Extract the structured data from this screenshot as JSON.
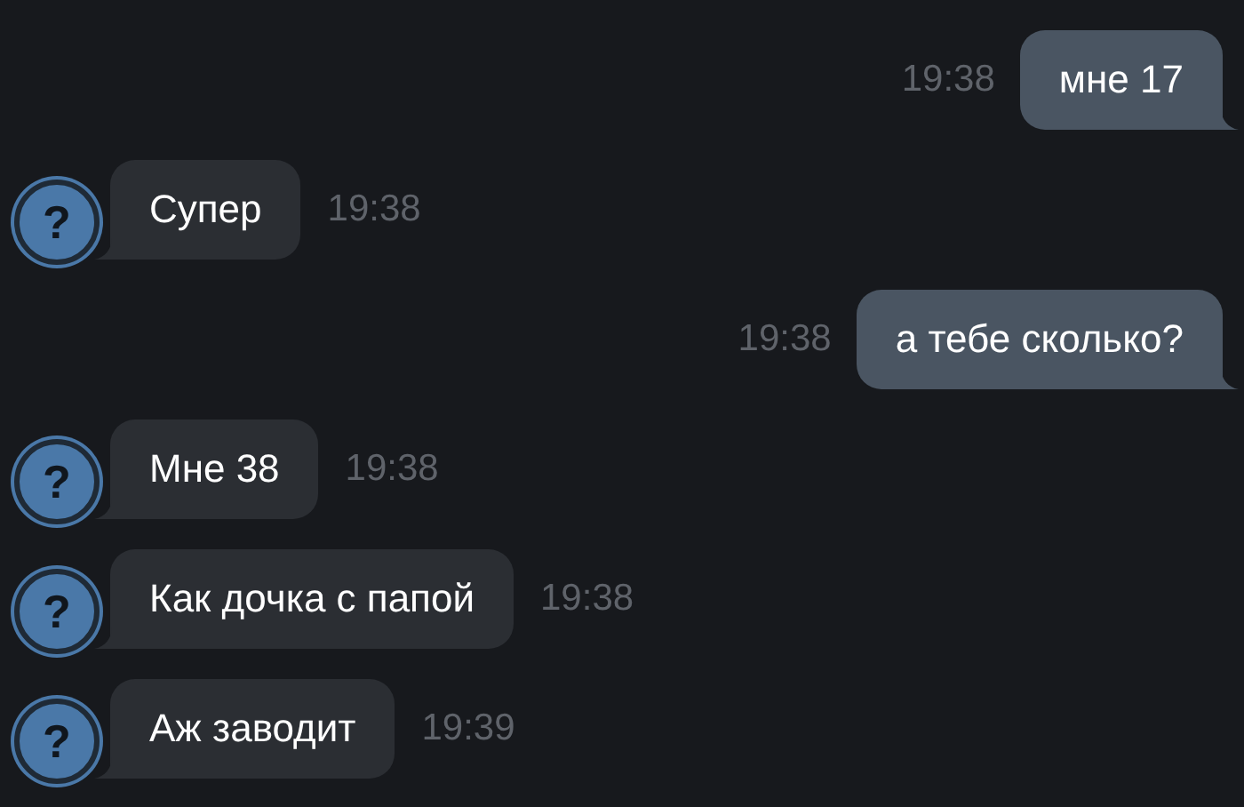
{
  "messages": [
    {
      "kind": "out",
      "text": "мне 17",
      "time": "19:38"
    },
    {
      "kind": "in",
      "avatar": "?",
      "text": "Супер",
      "time": "19:38"
    },
    {
      "kind": "out",
      "text": "а тебе сколько?",
      "time": "19:38"
    },
    {
      "kind": "in",
      "avatar": "?",
      "text": "Мне 38",
      "time": "19:38"
    },
    {
      "kind": "in",
      "avatar": "?",
      "text": "Как дочка с папой",
      "time": "19:38"
    },
    {
      "kind": "in",
      "avatar": "?",
      "text": "Аж заводит",
      "time": "19:39"
    }
  ]
}
